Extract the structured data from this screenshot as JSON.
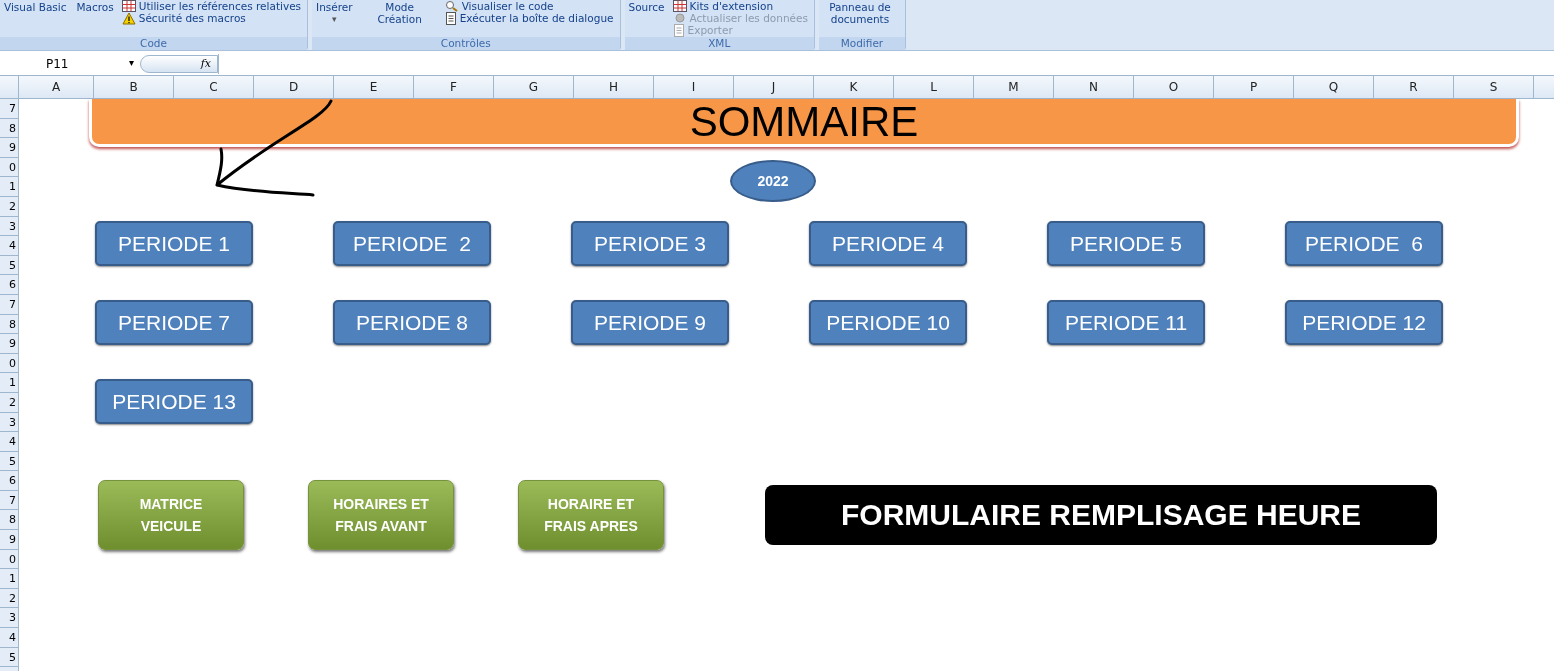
{
  "ribbon": {
    "groups": [
      {
        "label": "Code",
        "large": [
          {
            "text": "Visual Basic"
          },
          {
            "text": "Macros"
          }
        ],
        "small": [
          {
            "text": "Utiliser les références relatives",
            "disabled": false
          },
          {
            "text": "Sécurité des macros",
            "disabled": false
          }
        ]
      },
      {
        "label": "Contrôles",
        "large": [
          {
            "text": "Insérer",
            "caret": "▾"
          },
          {
            "text": "Mode Création"
          }
        ],
        "small": [
          {
            "text": "Visualiser le code",
            "disabled": false
          },
          {
            "text": "Exécuter la boîte de dialogue",
            "disabled": false
          }
        ]
      },
      {
        "label": "XML",
        "large": [
          {
            "text": "Source"
          }
        ],
        "small": [
          {
            "text": "Kits d'extension",
            "disabled": false
          },
          {
            "text": "Actualiser les données",
            "disabled": true
          },
          {
            "text": "Exporter",
            "disabled": true
          }
        ]
      },
      {
        "label": "Modifier",
        "large": [
          {
            "text": "Panneau de documents"
          }
        ]
      }
    ]
  },
  "formula_bar": {
    "name_box": "P11",
    "dropdown": "▾",
    "fx": "fx"
  },
  "columns": [
    "A",
    "B",
    "C",
    "D",
    "E",
    "F",
    "G",
    "H",
    "I",
    "J",
    "K",
    "L",
    "M",
    "N",
    "O",
    "P",
    "Q",
    "R",
    "S"
  ],
  "rows": [
    "7",
    "8",
    "9",
    "0",
    "1",
    "2",
    "3",
    "4",
    "5",
    "6",
    "7",
    "8",
    "9",
    "0",
    "1",
    "2",
    "3",
    "4",
    "5",
    "6",
    "7",
    "8",
    "9",
    "0",
    "1",
    "2",
    "3",
    "4",
    "5"
  ],
  "sheet": {
    "title": "SOMMAIRE",
    "year": "2022",
    "periods": [
      "PERIODE 1",
      "PERIODE  2",
      "PERIODE 3",
      "PERIODE 4",
      "PERIODE 5",
      "PERIODE  6",
      "PERIODE 7",
      "PERIODE 8",
      "PERIODE 9",
      "PERIODE 10",
      "PERIODE 11",
      "PERIODE 12",
      "PERIODE 13"
    ],
    "actions": [
      {
        "kind": "green",
        "text": "MATRICE VEICULE"
      },
      {
        "kind": "green",
        "text": "HORAIRES ET FRAIS AVANT"
      },
      {
        "kind": "green",
        "text": "HORAIRE ET FRAIS APRES"
      },
      {
        "kind": "black",
        "text": "FORMULAIRE REMPLISAGE HEURE"
      }
    ]
  }
}
